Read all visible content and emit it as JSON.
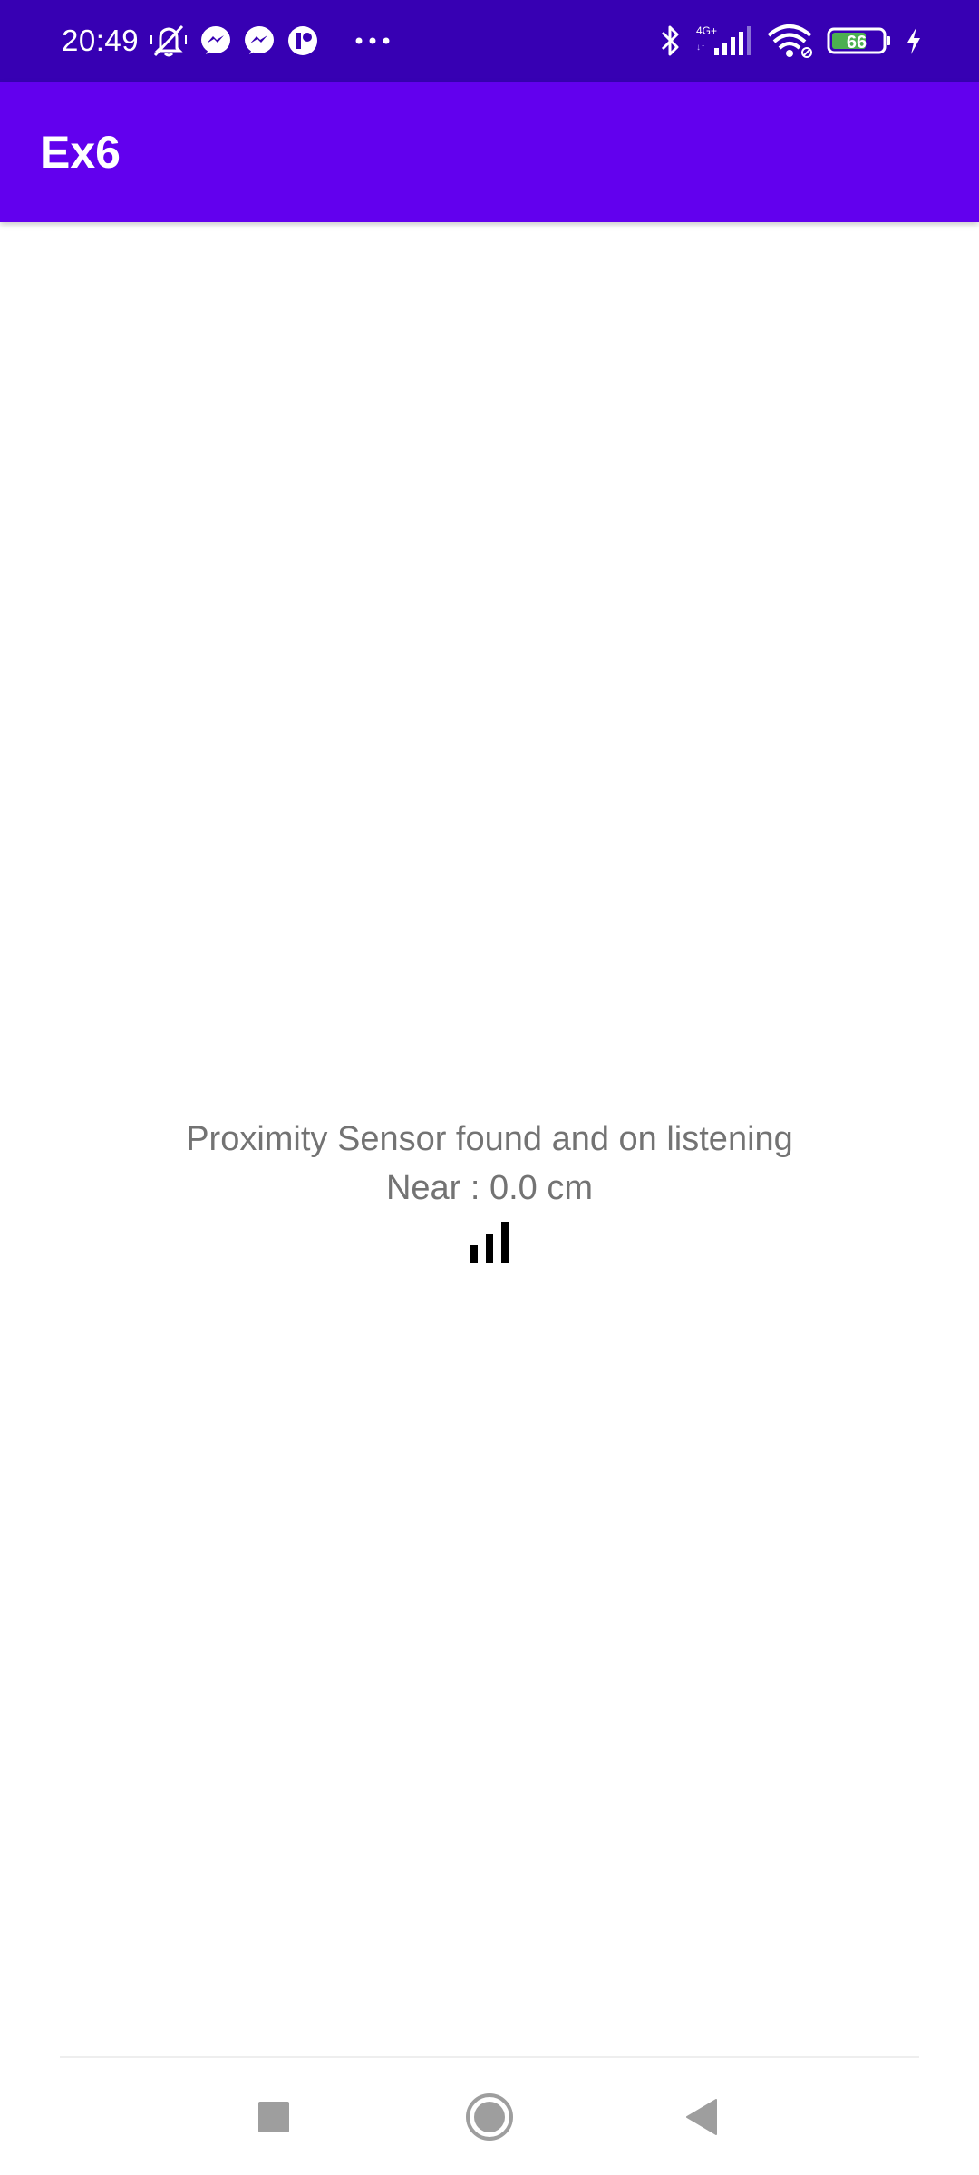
{
  "status_bar": {
    "time": "20:49",
    "battery_level": "66",
    "network": "4G+",
    "background_color": "#3700b3",
    "icons": [
      "mute-bell-icon",
      "messenger-icon",
      "messenger-icon",
      "app-notification-icon",
      "more-dots-icon",
      "bluetooth-icon",
      "cell-signal-icon",
      "wifi-icon",
      "battery-icon",
      "charging-icon"
    ]
  },
  "app_bar": {
    "title": "Ex6",
    "background_color": "#6200ee"
  },
  "content": {
    "status_line": "Proximity Sensor found and on listening",
    "reading_line": "Near : 0.0 cm",
    "indicator_icon": "signal-bars-icon"
  },
  "nav_bar": {
    "buttons": [
      "recents-square-icon",
      "home-circle-icon",
      "back-triangle-icon"
    ]
  }
}
